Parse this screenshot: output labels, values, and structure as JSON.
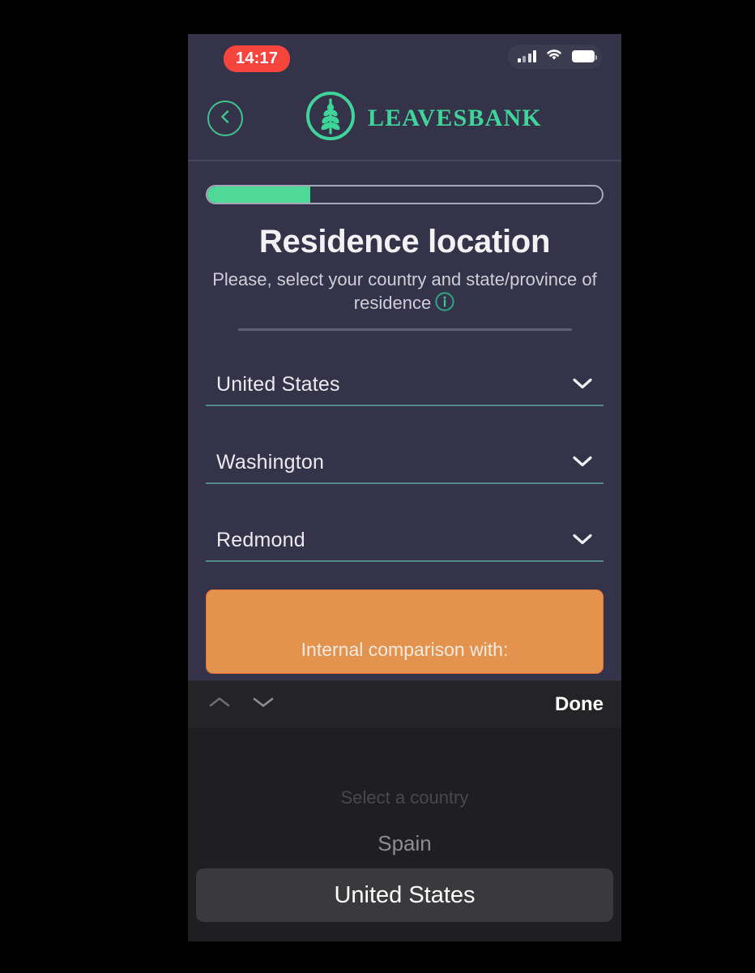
{
  "status_bar": {
    "time": "14:17",
    "recording_indicator_color": "#f5453c",
    "icons": [
      "cellular-signal-icon",
      "wifi-icon",
      "battery-icon"
    ]
  },
  "header": {
    "back_icon": "chevron-left-icon",
    "logo_icon": "tree-leaf-logo-icon",
    "brand_name": "LEAVESBANK",
    "brand_color": "#3fd49a"
  },
  "progress": {
    "percent": 26,
    "fill_color": "#4fd996",
    "track_color": "#a7a6bb"
  },
  "main": {
    "title": "Residence location",
    "subtitle": "Please, select your country and state/province of residence",
    "info_icon": "info-circle-icon"
  },
  "fields": [
    {
      "name": "country",
      "value": "United States",
      "chevron": "chevron-down-icon"
    },
    {
      "name": "state",
      "value": "Washington",
      "chevron": "chevron-down-icon"
    },
    {
      "name": "city",
      "value": "Redmond",
      "chevron": "chevron-down-icon"
    }
  ],
  "cta": {
    "label": "Internal comparison with:",
    "background_color": "#e4934f"
  },
  "picker": {
    "done_label": "Done",
    "prev_icon": "chevron-up-icon",
    "next_icon": "chevron-down-icon",
    "placeholder": "Select a country",
    "options": [
      {
        "label": "Select a country",
        "state": "ghost"
      },
      {
        "label": "Spain",
        "state": "far"
      },
      {
        "label": "United States",
        "state": "selected"
      }
    ]
  }
}
